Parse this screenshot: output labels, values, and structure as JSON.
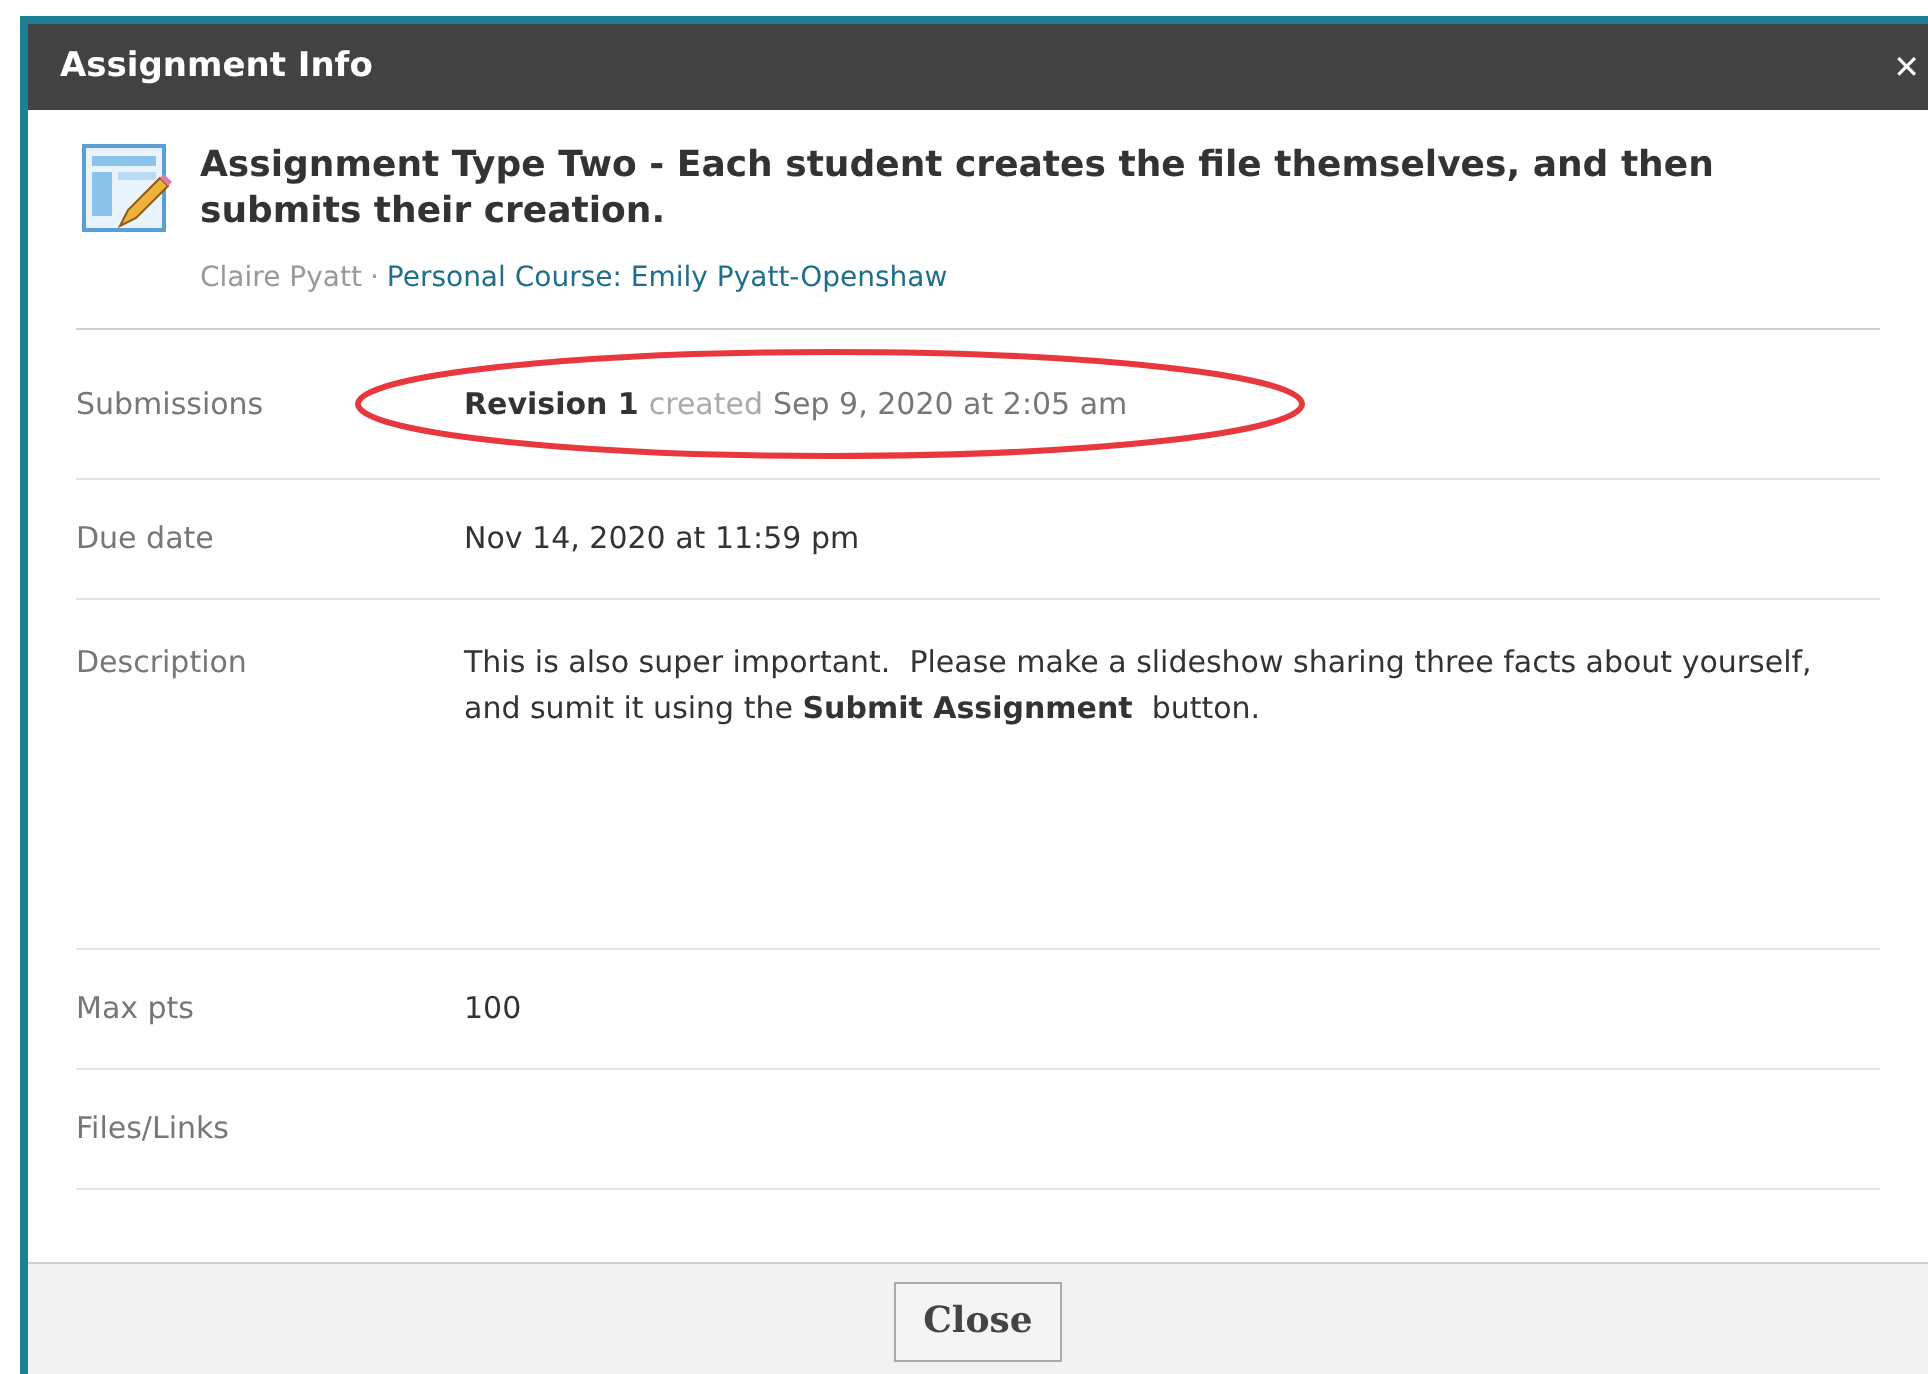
{
  "dialog": {
    "title": "Assignment Info",
    "close_glyph": "✕"
  },
  "assignment": {
    "title": "Assignment Type Two - Each student creates the file themselves, and then submits their creation.",
    "author": "Claire Pyatt",
    "separator": "·",
    "course": "Personal Course: Emily Pyatt-Openshaw"
  },
  "fields": [
    {
      "label": "Submissions",
      "kind": "submission",
      "revision": "Revision 1",
      "created_label": "created",
      "created_date": "Sep 9, 2020 at 2:05 am",
      "highlighted": true
    },
    {
      "label": "Due date",
      "kind": "text",
      "value": "Nov 14, 2020 at 11:59 pm"
    },
    {
      "label": "Description",
      "kind": "description",
      "value": "This is also super important.  Please make a slideshow sharing three facts about yourself, and sumit it using the **Submit Assignment**  button."
    },
    {
      "label": "Max pts",
      "kind": "text",
      "value": "100"
    },
    {
      "label": "Files/Links",
      "kind": "empty"
    }
  ],
  "buttons": [
    {
      "label": "Close"
    }
  ]
}
